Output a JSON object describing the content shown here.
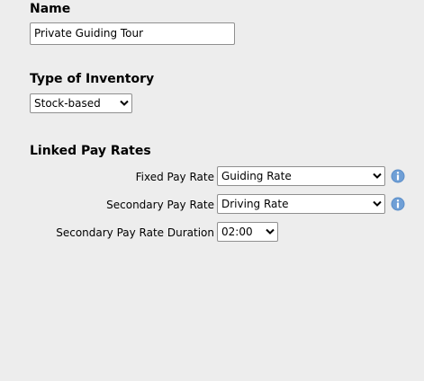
{
  "name": {
    "label": "Name",
    "value": "Private Guiding Tour"
  },
  "inventory": {
    "label": "Type of Inventory",
    "selected": "Stock-based"
  },
  "pay_rates": {
    "label": "Linked Pay Rates",
    "fixed": {
      "label": "Fixed Pay Rate",
      "selected": "Guiding Rate"
    },
    "secondary": {
      "label": "Secondary Pay Rate",
      "selected": "Driving Rate"
    },
    "duration": {
      "label": "Secondary Pay Rate Duration",
      "selected": "02:00"
    }
  },
  "colors": {
    "info_icon": "#5b8ec9",
    "background": "#ededed"
  },
  "icons": {
    "dropdown": "chevron-down-icon",
    "info": "info-icon"
  }
}
